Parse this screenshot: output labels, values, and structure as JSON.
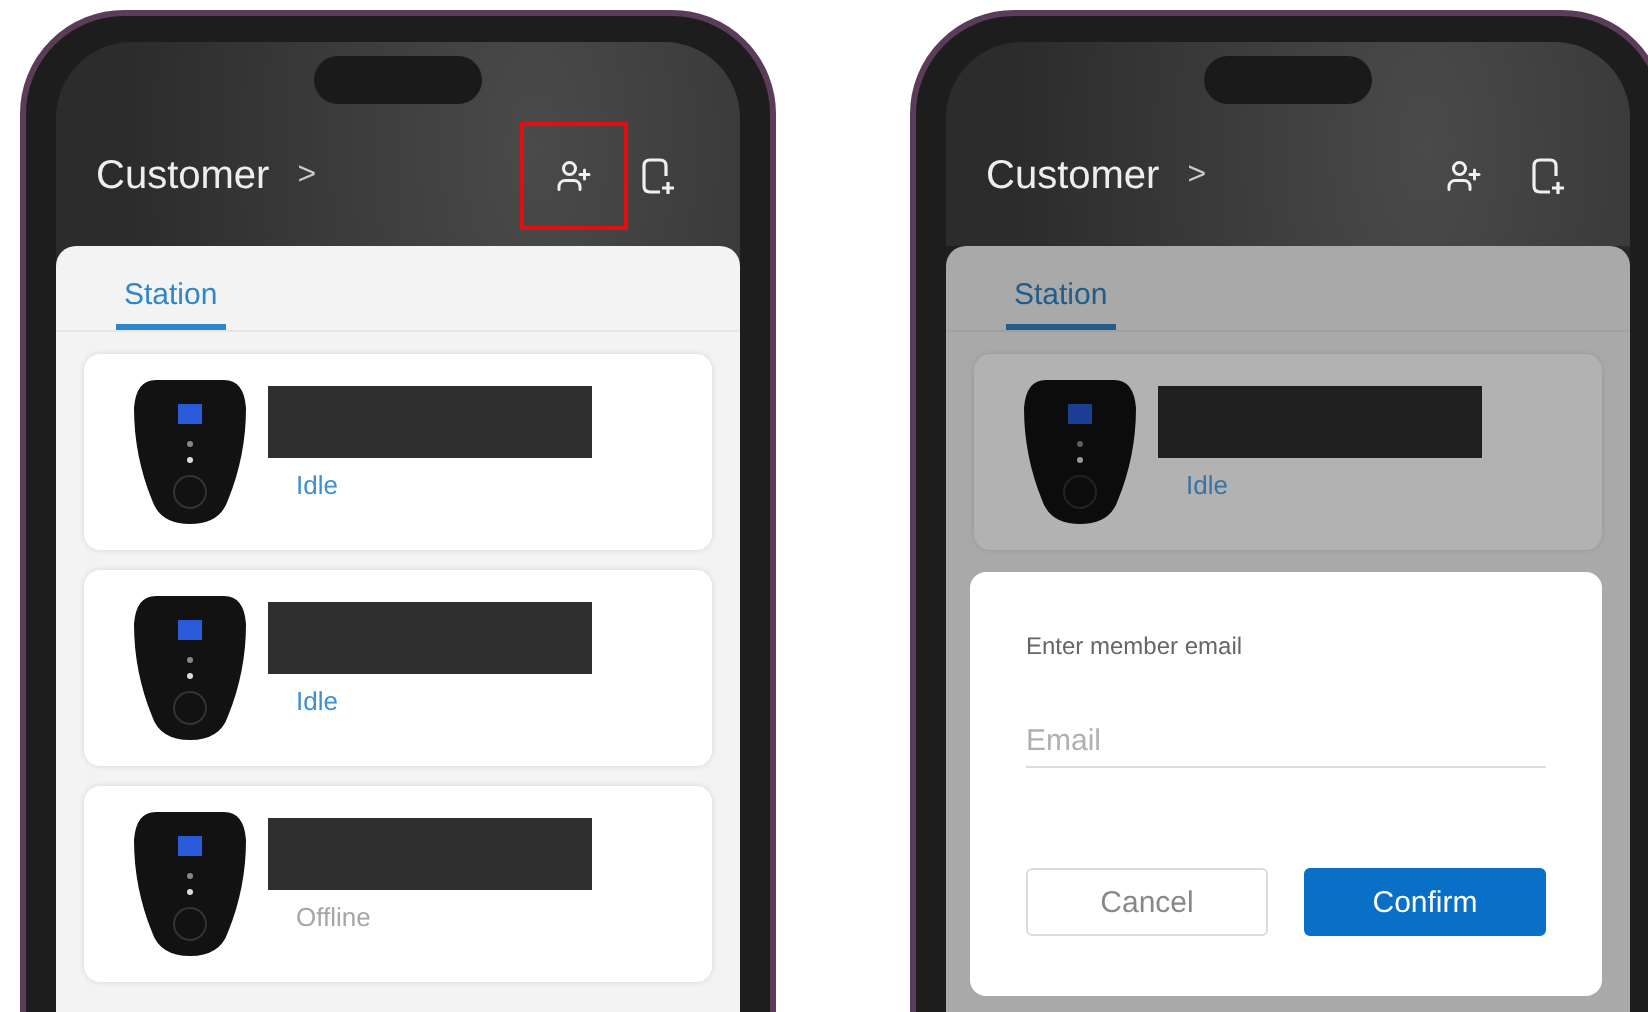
{
  "screens": [
    {
      "header": {
        "title": "Customer",
        "chevron": ">",
        "actions": [
          {
            "kind": "add-user",
            "highlighted": true
          },
          {
            "kind": "add-device",
            "highlighted": false
          }
        ]
      },
      "tabs": [
        {
          "label": "Station",
          "selected": true
        }
      ],
      "stations": [
        {
          "status": "Idle",
          "color": "#3d8fd0"
        },
        {
          "status": "Idle",
          "color": "#3d8fd0"
        },
        {
          "status": "Offline",
          "color": "#a6a6a6"
        }
      ],
      "dimmed": false
    },
    {
      "header": {
        "title": "Customer",
        "chevron": ">",
        "actions": [
          {
            "kind": "add-user",
            "highlighted": false
          },
          {
            "kind": "add-device",
            "highlighted": false
          }
        ]
      },
      "tabs": [
        {
          "label": "Station",
          "selected": true
        }
      ],
      "stations": [
        {
          "status": "Idle",
          "color": "#3a72a4"
        }
      ],
      "dimmed": true,
      "dialog": {
        "title": "Enter member email",
        "placeholder": "Email",
        "buttons": [
          {
            "label": "Cancel",
            "kind": "secondary"
          },
          {
            "label": "Confirm",
            "kind": "primary"
          }
        ]
      }
    }
  ]
}
